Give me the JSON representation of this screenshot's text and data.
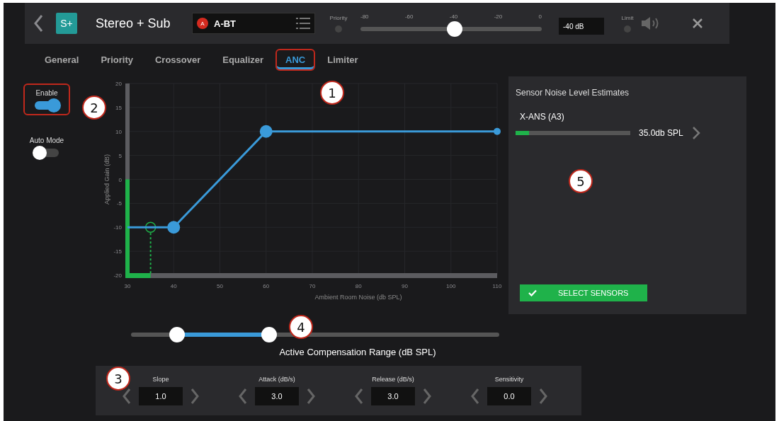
{
  "header": {
    "badge": "S+",
    "title": "Stereo + Sub",
    "source": {
      "badge": "A",
      "name": "A-BT"
    },
    "priority_label": "Priority",
    "priority_slider": {
      "ticks": [
        "-80",
        "-60",
        "-40",
        "-20",
        "0"
      ],
      "level": 0.52
    },
    "gain_value": "-40 dB",
    "limit_label": "Limit"
  },
  "tabs": [
    {
      "label": "General",
      "selected": false,
      "highlighted": false
    },
    {
      "label": "Priority",
      "selected": false,
      "highlighted": false
    },
    {
      "label": "Crossover",
      "selected": false,
      "highlighted": false
    },
    {
      "label": "Equalizer",
      "selected": false,
      "highlighted": false
    },
    {
      "label": "ANC",
      "selected": true,
      "highlighted": true
    },
    {
      "label": "Limiter",
      "selected": false,
      "highlighted": false
    }
  ],
  "toggles": [
    {
      "label": "Enable",
      "on": true,
      "highlighted": true
    },
    {
      "label": "Auto Mode",
      "on": false,
      "highlighted": false
    }
  ],
  "chart": {
    "chart_data": {
      "type": "line",
      "xlabel": "Ambient Room Noise (db SPL)",
      "ylabel": "Applied Gain (dB)",
      "x": [
        30,
        40,
        60,
        110
      ],
      "series": [
        {
          "color": "#3a9ad9",
          "values": [
            -10,
            -10,
            10,
            10
          ]
        }
      ],
      "xlim": [
        30,
        110
      ],
      "ylim": [
        -20,
        20
      ],
      "xticks": [
        30,
        40,
        50,
        60,
        70,
        80,
        90,
        100,
        110
      ],
      "yticks": [
        -20,
        -15,
        -10,
        -5,
        0,
        5,
        10,
        15,
        20
      ],
      "grid": true,
      "ref_lines": [
        {
          "axis": "x",
          "value": 35,
          "color": "#1fb24a"
        }
      ]
    }
  },
  "sensor_panel": {
    "title": "Sensor Noise Level Estimates",
    "sensors": [
      {
        "name": "X-ANS (A3)",
        "level": 0.12,
        "reading": "35.0db SPL"
      }
    ],
    "button": "SELECT SENSORS"
  },
  "range_slider": {
    "thumbs": [
      {
        "level": 0.125
      },
      {
        "level": 0.375
      }
    ],
    "label": "Active Compensation Range (dB SPL)"
  },
  "parameters": [
    {
      "label": "Slope",
      "value": "1.0"
    },
    {
      "label": "Attack (dB/s)",
      "value": "3.0"
    },
    {
      "label": "Release (dB/s)",
      "value": "3.0"
    },
    {
      "label": "Sensitivity",
      "value": "0.0"
    }
  ],
  "callouts": [
    {
      "number": "1"
    },
    {
      "number": "2"
    },
    {
      "number": "3"
    },
    {
      "number": "4"
    },
    {
      "number": "5"
    }
  ]
}
